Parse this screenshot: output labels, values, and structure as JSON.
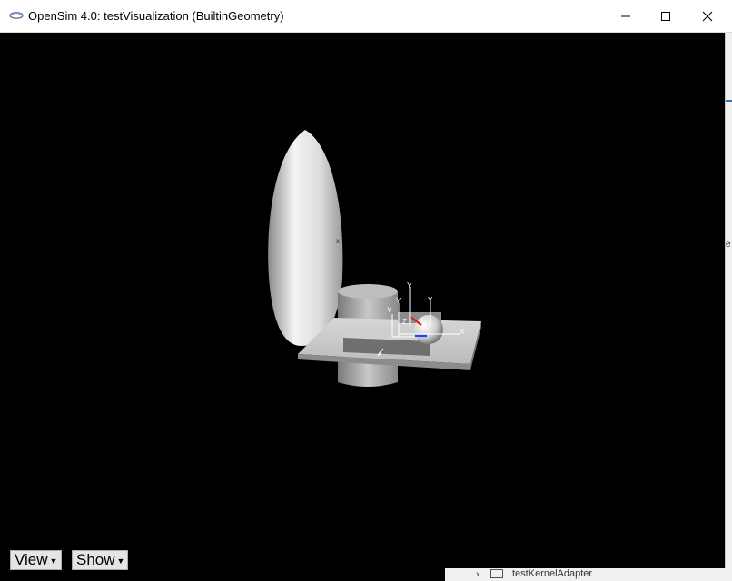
{
  "window": {
    "title": "OpenSim 4.0: testVisualization (BuiltinGeometry)",
    "icon": "opensim-app-icon",
    "controls": [
      "minimize-icon",
      "maximize-icon",
      "close-icon"
    ]
  },
  "scene": {
    "axis_labels": {
      "y1": "Y",
      "y2": "Y",
      "y3": "Y",
      "y4": "Y",
      "x1": "X",
      "z1": "Z",
      "z2": "Z",
      "x_small": "x"
    },
    "background_color": "#000000",
    "axis_colors": {
      "x": "#e02020",
      "z": "#2040ff"
    }
  },
  "toolbar": {
    "view_label": "View",
    "show_label": "Show",
    "dropdown_icon": "caret-down-icon"
  },
  "background_window": {
    "partial_text": "testKernelAdapter",
    "edge_letter": "e"
  }
}
